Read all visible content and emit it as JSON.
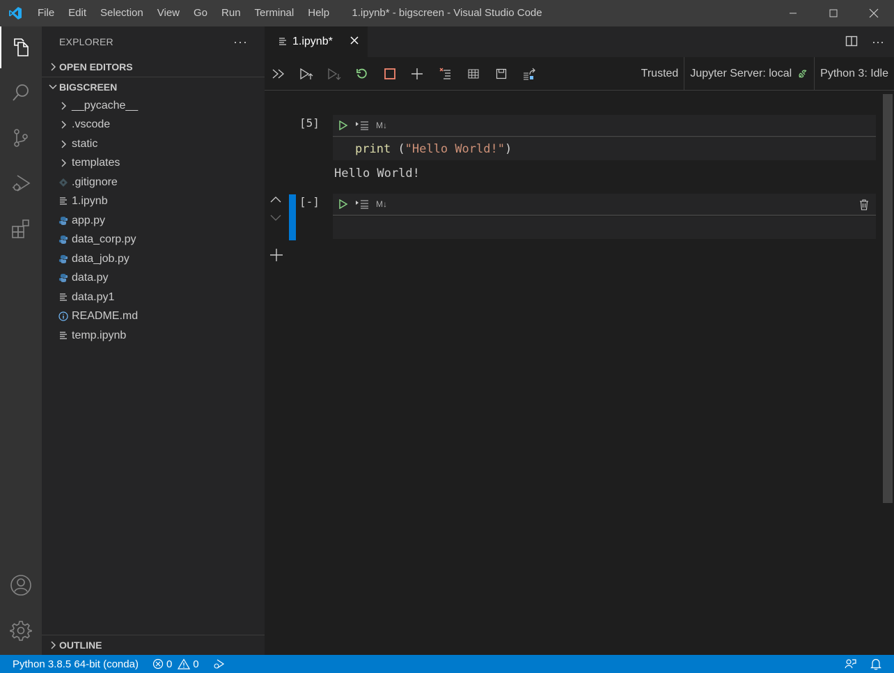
{
  "window": {
    "title": "1.ipynb* - bigscreen - Visual Studio Code",
    "menu": [
      "File",
      "Edit",
      "Selection",
      "View",
      "Go",
      "Run",
      "Terminal",
      "Help"
    ]
  },
  "sidebar": {
    "header": "EXPLORER",
    "open_editors": "OPEN EDITORS",
    "project": "BIGSCREEN",
    "outline": "OUTLINE",
    "items": [
      {
        "label": "__pycache__",
        "icon": "chevron-right-icon"
      },
      {
        "label": ".vscode",
        "icon": "chevron-right-icon"
      },
      {
        "label": "static",
        "icon": "chevron-right-icon"
      },
      {
        "label": "templates",
        "icon": "chevron-right-icon"
      },
      {
        "label": ".gitignore",
        "icon": "git-file-icon"
      },
      {
        "label": "1.ipynb",
        "icon": "file-lines-icon"
      },
      {
        "label": "app.py",
        "icon": "python-icon"
      },
      {
        "label": "data_corp.py",
        "icon": "python-icon"
      },
      {
        "label": "data_job.py",
        "icon": "python-icon"
      },
      {
        "label": "data.py",
        "icon": "python-icon"
      },
      {
        "label": "data.py1",
        "icon": "file-lines-icon"
      },
      {
        "label": "README.md",
        "icon": "info-icon"
      },
      {
        "label": "temp.ipynb",
        "icon": "file-lines-icon"
      }
    ]
  },
  "editor": {
    "tab_label": "1.ipynb*",
    "toolbar": {
      "trusted": "Trusted",
      "server": "Jupyter Server: local",
      "kernel": "Python 3: Idle"
    },
    "cells": [
      {
        "count": "[5]",
        "code_fn": "print",
        "code_open": " (",
        "code_str": "\"Hello World!\"",
        "code_close": ")",
        "output": "Hello World!",
        "md_label": "M↓"
      },
      {
        "count": "[-]",
        "md_label": "M↓"
      }
    ]
  },
  "statusbar": {
    "interpreter": "Python 3.8.5 64-bit (conda)",
    "errors": "0",
    "warnings": "0"
  },
  "colors": {
    "accent": "#007acc",
    "run_green": "#89d185",
    "stop_red": "#f48771"
  }
}
